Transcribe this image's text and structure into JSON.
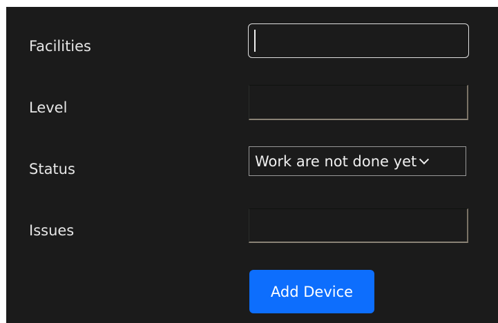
{
  "form": {
    "facilities": {
      "label": "Facilities",
      "value": ""
    },
    "level": {
      "label": "Level",
      "value": ""
    },
    "status": {
      "label": "Status",
      "selected": "Work are not done yet"
    },
    "issues": {
      "label": "Issues",
      "value": ""
    },
    "submit_label": "Add Device"
  },
  "colors": {
    "background": "#1b1b1b",
    "button": "#0d6efd",
    "text": "#e6e6e6"
  }
}
